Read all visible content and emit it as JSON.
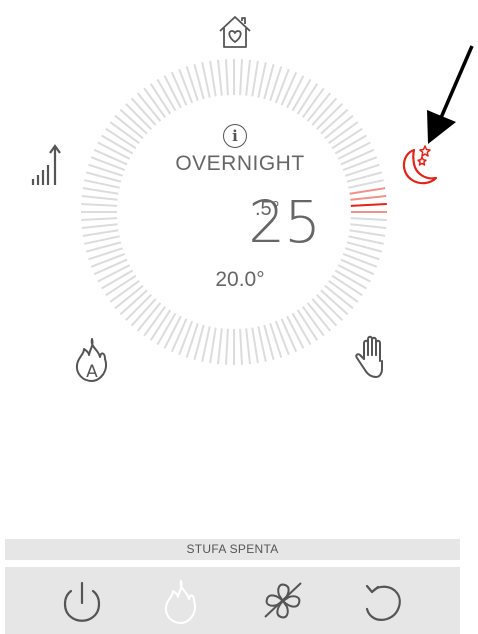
{
  "thermostat": {
    "mode": "OVERNIGHT",
    "current_temp_int": "25",
    "current_temp_frac": ".5°",
    "set_temp": "20.0°"
  },
  "icons": {
    "top": "home-heart-icon",
    "right": "overnight-moon-stars-icon",
    "left": "signal-power-icon",
    "bottom_left": "auto-flame-icon",
    "bottom_right": "manual-hand-icon",
    "center": "info-icon",
    "annotation": "arrow-pointer-icon"
  },
  "status": {
    "text": "STUFA SPENTA"
  },
  "toolbar": {
    "buttons": [
      "power-icon",
      "flame-icon",
      "fan-off-icon",
      "reset-icon"
    ]
  },
  "colors": {
    "accent_red": "#e2231a",
    "dial_gray": "#dcdcdc",
    "icon_gray": "#555555",
    "bar_bg": "#e6e6e6"
  }
}
